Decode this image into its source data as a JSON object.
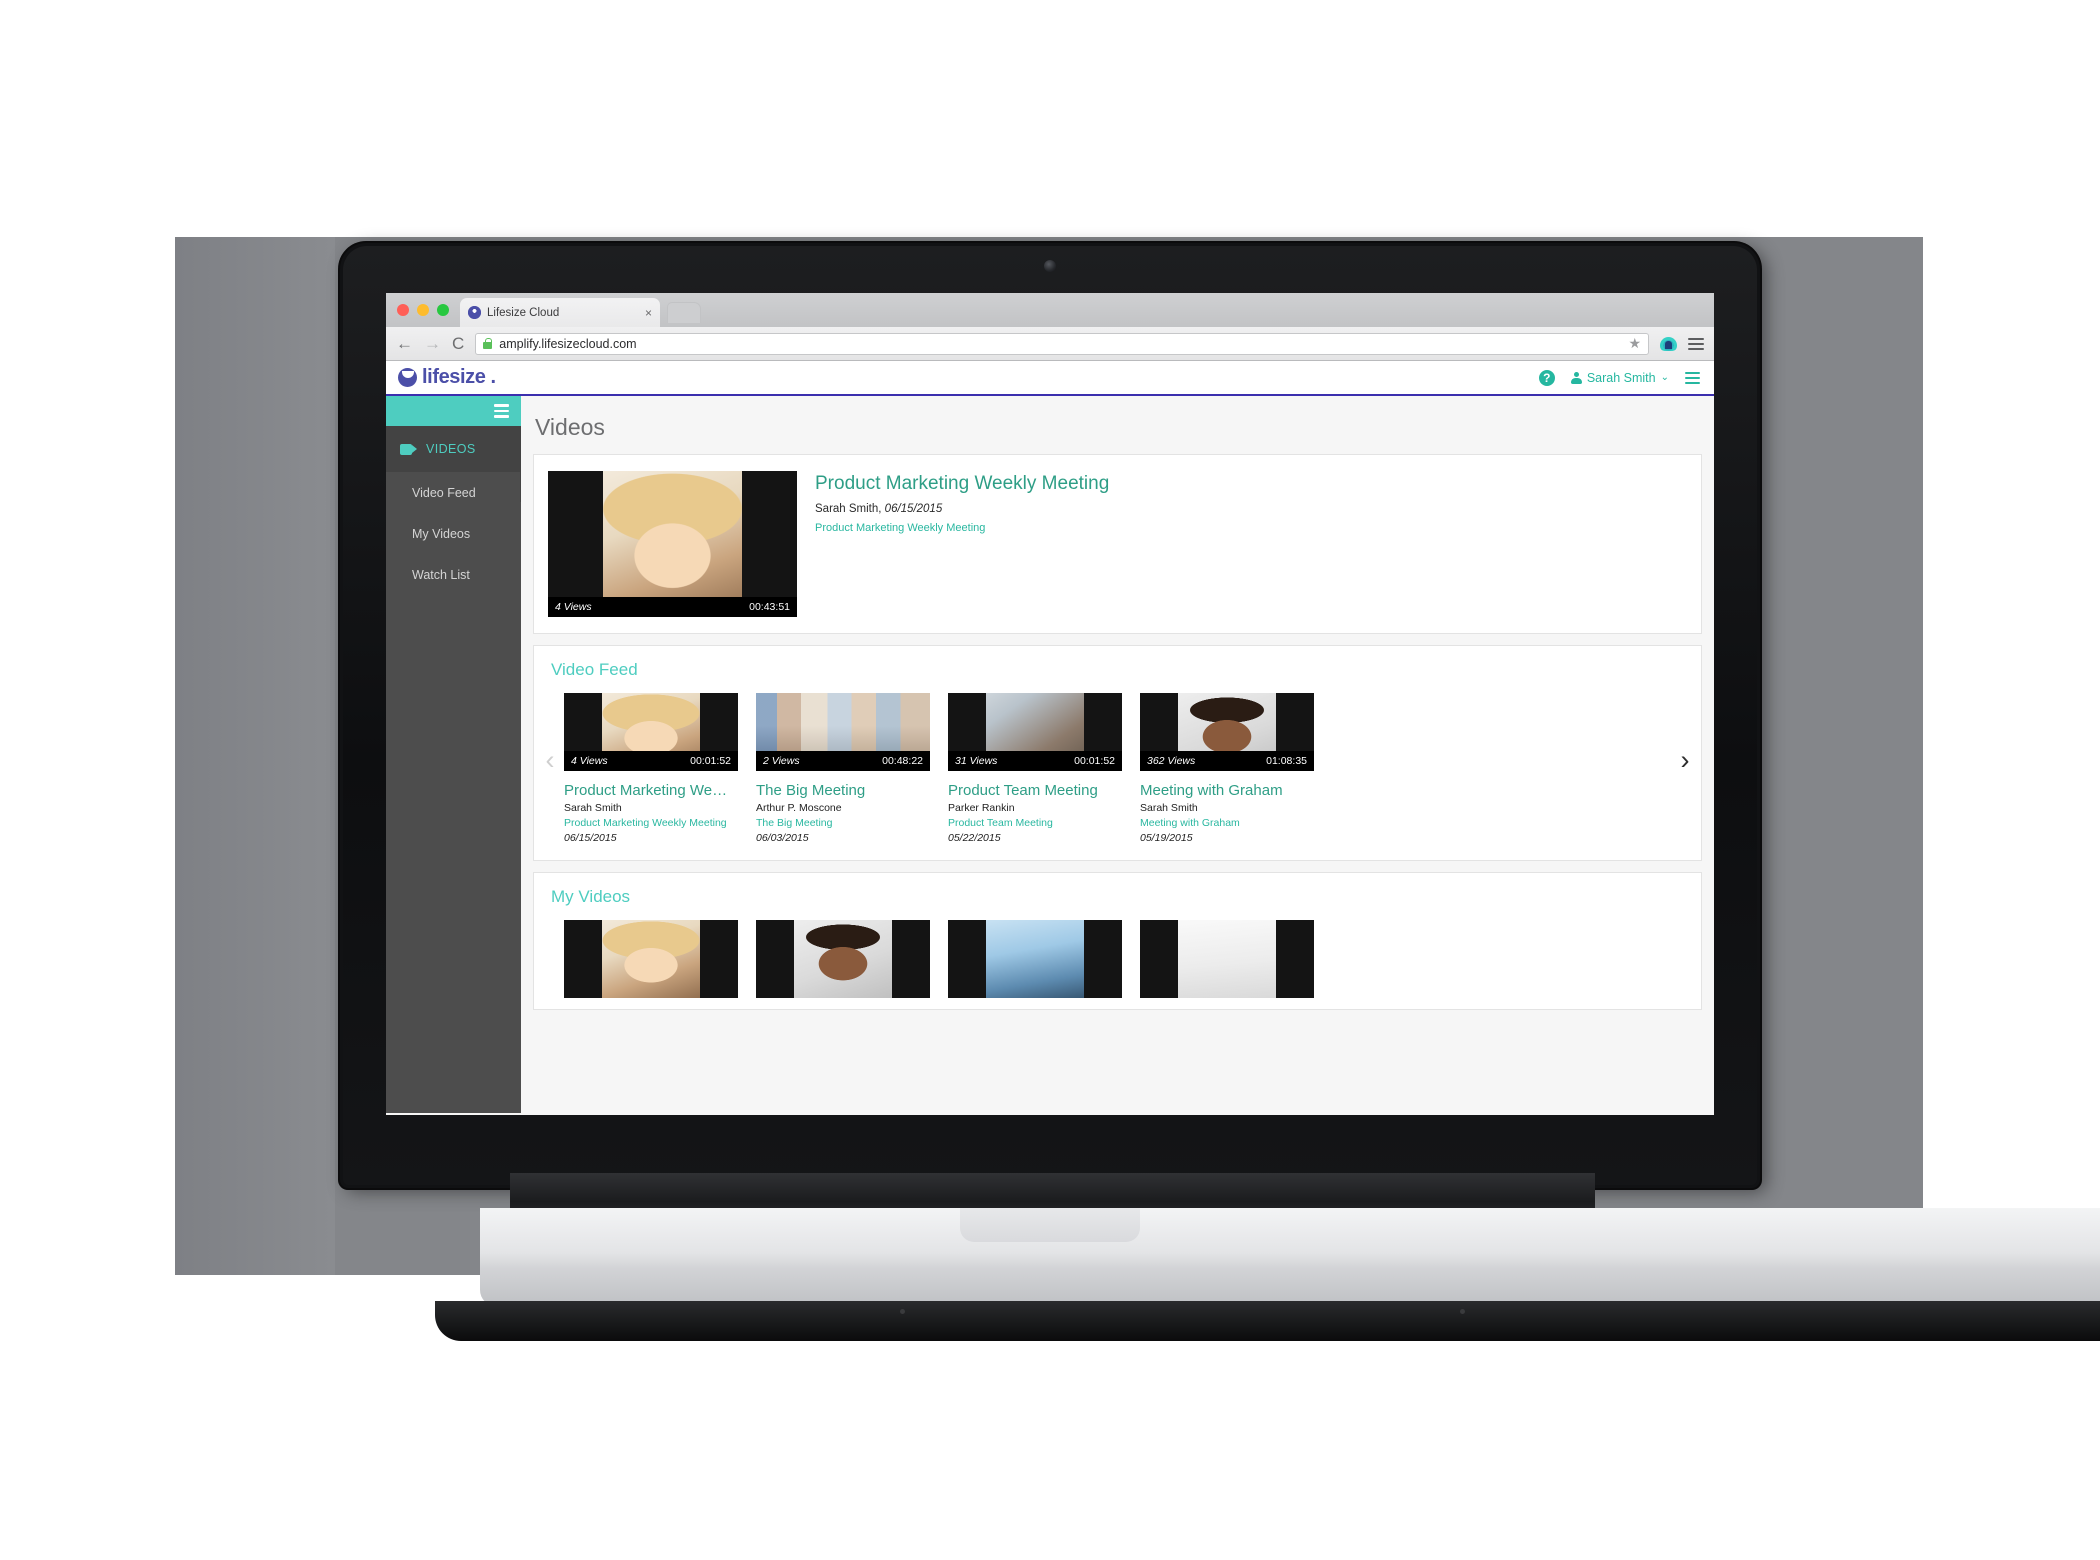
{
  "browser": {
    "tab_title": "Lifesize Cloud",
    "tab_close": "×",
    "url": "amplify.lifesizecloud.com",
    "back_icon": "←",
    "forward_icon": "→",
    "reload_icon": "C",
    "star_icon": "★"
  },
  "app": {
    "brand": "lifesize",
    "brand_dot": ".",
    "help_label": "?",
    "user_name": "Sarah Smith",
    "chevron": "⌄"
  },
  "sidebar": {
    "section_label": "VIDEOS",
    "items": [
      {
        "label": "Video Feed"
      },
      {
        "label": "My Videos"
      },
      {
        "label": "Watch List"
      }
    ]
  },
  "main": {
    "page_title": "Videos",
    "featured": {
      "title": "Product Marketing Weekly Meeting",
      "author": "Sarah Smith",
      "date": "06/15/2015",
      "meeting_link": "Product Marketing Weekly Meeting",
      "views": "4 Views",
      "duration": "00:43:51"
    },
    "sections": [
      {
        "title": "Video Feed",
        "prev_arrow": "‹",
        "next_arrow": "›",
        "videos": [
          {
            "title": "Product Marketing We…",
            "author": "Sarah Smith",
            "meeting_link": "Product Marketing Weekly Meeting",
            "date": "06/15/2015",
            "views": "4 Views",
            "duration": "00:01:52"
          },
          {
            "title": "The Big Meeting",
            "author": "Arthur P. Moscone",
            "meeting_link": "The Big Meeting",
            "date": "06/03/2015",
            "views": "2 Views",
            "duration": "00:48:22"
          },
          {
            "title": "Product Team Meeting",
            "author": "Parker Rankin",
            "meeting_link": "Product Team Meeting",
            "date": "05/22/2015",
            "views": "31 Views",
            "duration": "00:01:52"
          },
          {
            "title": "Meeting with Graham",
            "author": "Sarah Smith",
            "meeting_link": "Meeting with Graham",
            "date": "05/19/2015",
            "views": "362 Views",
            "duration": "01:08:35"
          }
        ]
      },
      {
        "title": "My Videos",
        "prev_arrow": "‹",
        "next_arrow": "›",
        "videos": [
          {
            "title": "",
            "author": "",
            "meeting_link": "",
            "date": "",
            "views": "",
            "duration": ""
          },
          {
            "title": "",
            "author": "",
            "meeting_link": "",
            "date": "",
            "views": "",
            "duration": ""
          },
          {
            "title": "",
            "author": "",
            "meeting_link": "",
            "date": "",
            "views": "",
            "duration": ""
          },
          {
            "title": "",
            "author": "",
            "meeting_link": "",
            "date": "",
            "views": "",
            "duration": ""
          }
        ]
      }
    ]
  },
  "colors": {
    "teal": "#4ecdc4",
    "teal_dark": "#2e9e86",
    "teal_link": "#29b7a0",
    "brand_purple": "#4b4fa8",
    "sidebar_bg": "#4d4d4d"
  }
}
